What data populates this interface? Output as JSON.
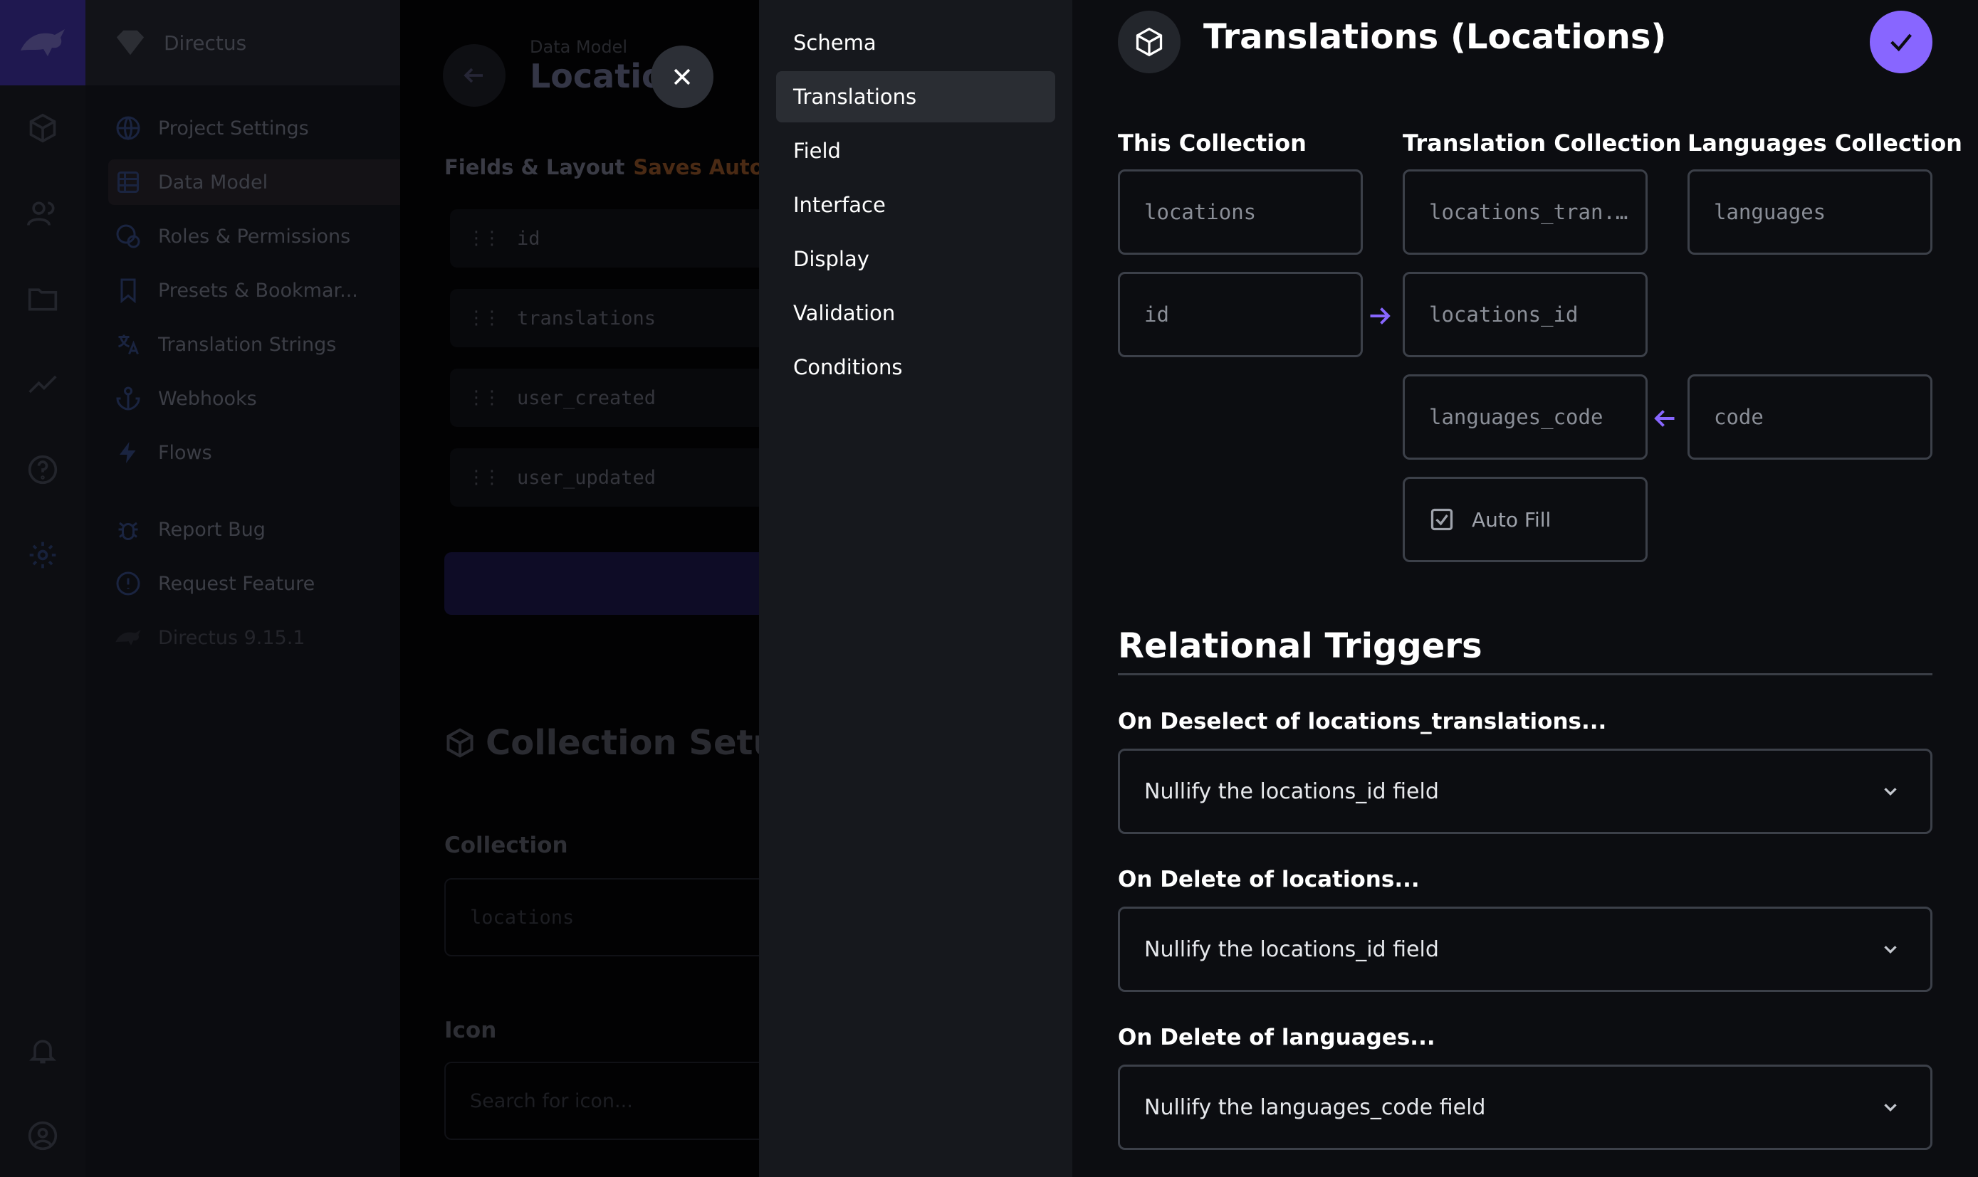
{
  "background": {
    "app_name": "Directus",
    "nav_items": [
      {
        "label": "Project Settings",
        "icon": "globe-icon"
      },
      {
        "label": "Data Model",
        "icon": "list-icon"
      },
      {
        "label": "Roles & Permissions",
        "icon": "roles-icon"
      },
      {
        "label": "Presets & Bookmar...",
        "icon": "bookmark-icon"
      },
      {
        "label": "Translation Strings",
        "icon": "translate-icon"
      },
      {
        "label": "Webhooks",
        "icon": "anchor-icon"
      },
      {
        "label": "Flows",
        "icon": "bolt-icon"
      },
      {
        "label": "Report Bug",
        "icon": "bug-icon"
      },
      {
        "label": "Request Feature",
        "icon": "feature-icon"
      },
      {
        "label": "Directus 9.15.1",
        "icon": "rabbit-icon"
      }
    ],
    "breadcrumb": "Data Model",
    "page_title": "Locatio",
    "fields_label": "Fields & Layout",
    "fields_note": "Saves Autom",
    "fields": [
      "id",
      "translations",
      "user_created",
      "user_updated"
    ],
    "setup_title": "Collection Setup",
    "collection_label": "Collection",
    "collection_value": "locations",
    "icon_label": "Icon",
    "icon_placeholder": "Search for icon..."
  },
  "drawer_nav": [
    {
      "label": "Schema",
      "active": false
    },
    {
      "label": "Translations",
      "active": true
    },
    {
      "label": "Field",
      "active": false
    },
    {
      "label": "Interface",
      "active": false
    },
    {
      "label": "Display",
      "active": false
    },
    {
      "label": "Validation",
      "active": false
    },
    {
      "label": "Conditions",
      "active": false
    }
  ],
  "drawer": {
    "title": "Translations (Locations)",
    "header_icon": "box-icon",
    "save_icon": "check-icon",
    "columns": {
      "this_collection": "This Collection",
      "translation_collection": "Translation Collection",
      "languages_collection": "Languages Collection"
    },
    "relation": {
      "this_collection": "locations",
      "translation_collection": "locations_tran...",
      "languages_collection": "languages",
      "this_field": "id",
      "translation_fk_this": "locations_id",
      "translation_fk_lang": "languages_code",
      "languages_field": "code",
      "auto_fill_label": "Auto Fill",
      "auto_fill_checked": true
    },
    "triggers_title": "Relational Triggers",
    "triggers": [
      {
        "label": "On Deselect of locations_translations...",
        "value": "Nullify the locations_id field"
      },
      {
        "label": "On Delete of locations...",
        "value": "Nullify the locations_id field"
      },
      {
        "label": "On Delete of languages...",
        "value": "Nullify the languages_code field"
      }
    ]
  },
  "colors": {
    "accent": "#8866ff",
    "drawer_bg": "#0c0d11",
    "drawer_nav_bg": "#16181d",
    "border": "#3c4049",
    "overlay_text": "#3c3e46"
  }
}
